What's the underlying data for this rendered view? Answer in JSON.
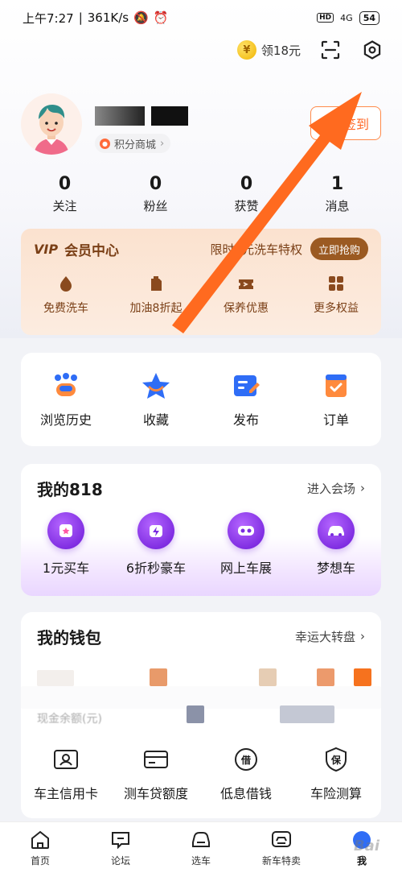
{
  "status_bar": {
    "time": "上午7:27",
    "speed": "361K/s",
    "network": "4G",
    "hd": "HD",
    "battery": "54"
  },
  "top_actions": {
    "coin_symbol": "¥",
    "coin_label": "领18元"
  },
  "profile": {
    "shop_label": "积分商城",
    "sign_label": "签到"
  },
  "stats": [
    {
      "num": "0",
      "label": "关注"
    },
    {
      "num": "0",
      "label": "粉丝"
    },
    {
      "num": "0",
      "label": "获赞"
    },
    {
      "num": "1",
      "label": "消息"
    }
  ],
  "vip": {
    "logo": "VIP",
    "title": "会员中心",
    "promo": "限时6元洗车特权",
    "button": "立即抢购",
    "items": [
      {
        "label": "免费洗车",
        "icon": "car-wash-icon"
      },
      {
        "label": "加油8折起",
        "icon": "fuel-can-icon"
      },
      {
        "label": "保养优惠",
        "icon": "ticket-icon"
      },
      {
        "label": "更多权益",
        "icon": "grid-icon"
      }
    ]
  },
  "quick": [
    {
      "label": "浏览历史",
      "icon": "history-icon"
    },
    {
      "label": "收藏",
      "icon": "star-icon"
    },
    {
      "label": "发布",
      "icon": "edit-icon"
    },
    {
      "label": "订单",
      "icon": "order-icon"
    }
  ],
  "p818": {
    "title": "我的818",
    "link": "进入会场",
    "items": [
      {
        "label": "1元买车",
        "icon": "buy-car-icon"
      },
      {
        "label": "6折秒豪车",
        "icon": "flash-car-icon"
      },
      {
        "label": "网上车展",
        "icon": "vr-icon"
      },
      {
        "label": "梦想车",
        "icon": "dream-car-icon"
      }
    ]
  },
  "wallet": {
    "title": "我的钱包",
    "link": "幸运大转盘",
    "balance_label": "现金余额(元)",
    "items": [
      {
        "label": "车主信用卡",
        "icon": "id-card-icon"
      },
      {
        "label": "测车贷额度",
        "icon": "credit-card-icon"
      },
      {
        "label": "低息借钱",
        "icon": "borrow-icon",
        "glyph": "借"
      },
      {
        "label": "车险测算",
        "icon": "insurance-icon",
        "glyph": "保"
      }
    ]
  },
  "tabbar": [
    {
      "label": "首页",
      "icon": "home-icon"
    },
    {
      "label": "论坛",
      "icon": "forum-icon"
    },
    {
      "label": "选车",
      "icon": "car-select-icon"
    },
    {
      "label": "新车特卖",
      "icon": "new-car-sale-icon"
    },
    {
      "label": "我",
      "icon": "me-icon"
    }
  ],
  "colors": {
    "accent_orange": "#ff6a2a",
    "vip_brown": "#7a3f16",
    "purple": "#6a17d6",
    "blue": "#2f6df6"
  },
  "watermark": "Bai"
}
